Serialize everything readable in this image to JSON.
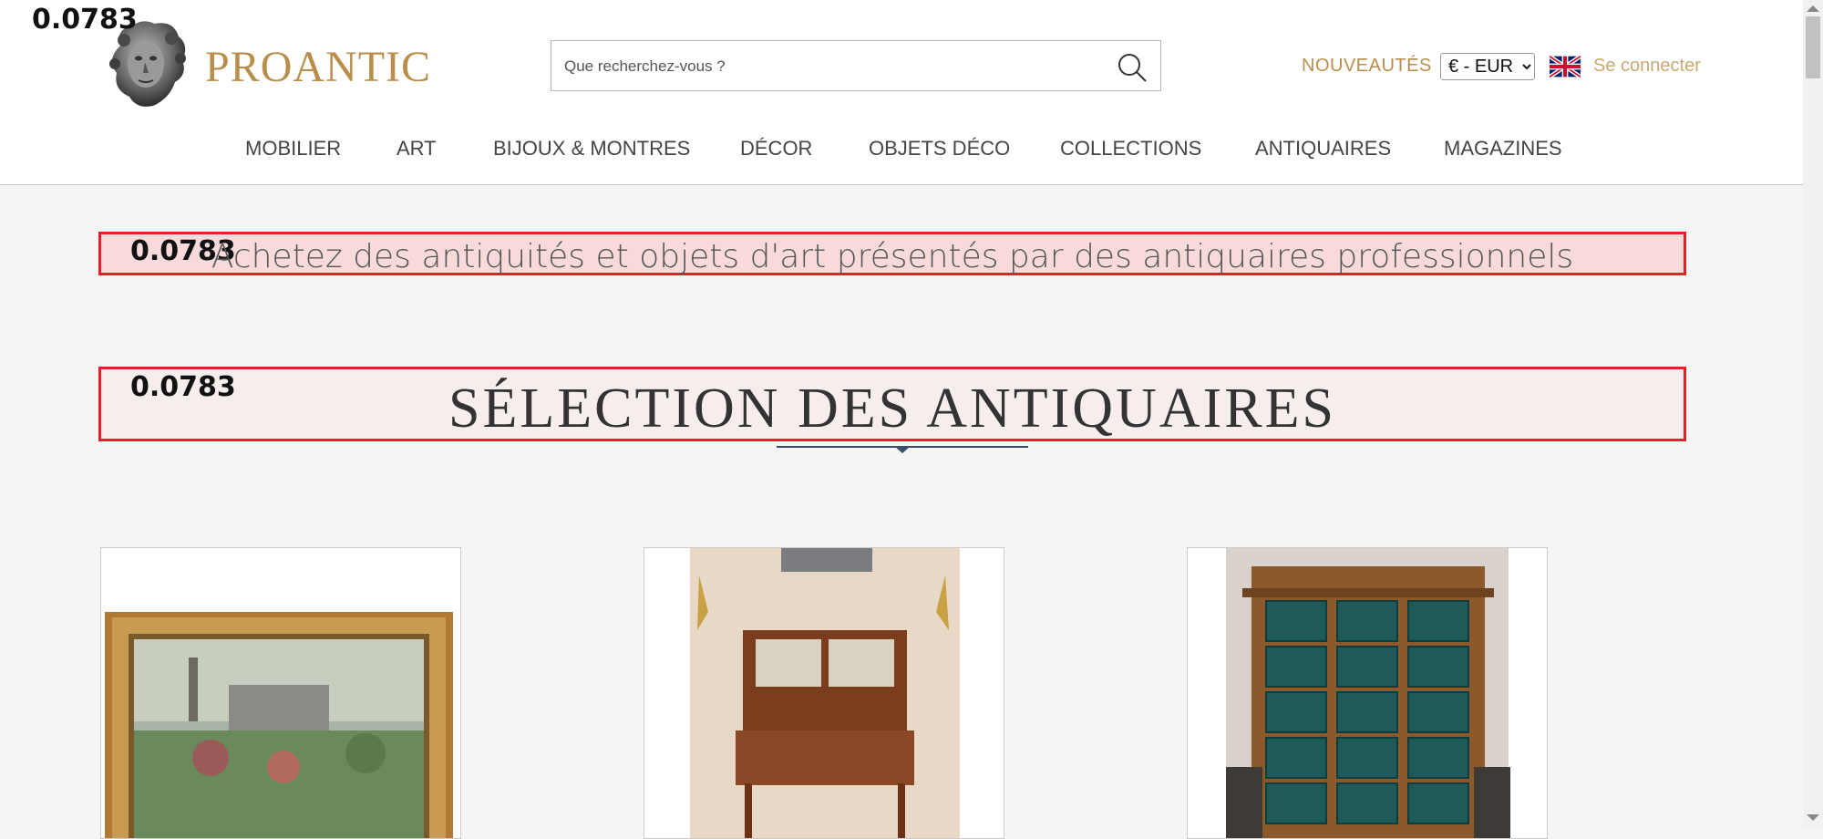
{
  "debug": {
    "score_value": "0.0783"
  },
  "brand": {
    "name": "PROANTIC",
    "color": "#b98e4b"
  },
  "search": {
    "placeholder": "Que recherchez-vous ?",
    "value": ""
  },
  "header": {
    "new_label": "NOUVEAUTÉS",
    "currency_selected": "€ - EUR",
    "currency_options": [
      "€ - EUR"
    ],
    "login_label": "Se connecter"
  },
  "nav": {
    "items": [
      {
        "label": "MOBILIER"
      },
      {
        "label": "ART"
      },
      {
        "label": "BIJOUX & MONTRES"
      },
      {
        "label": "DÉCOR"
      },
      {
        "label": "OBJETS DÉCO"
      },
      {
        "label": "COLLECTIONS"
      },
      {
        "label": "ANTIQUAIRES"
      },
      {
        "label": "MAGAZINES"
      }
    ]
  },
  "main": {
    "tagline": "Achetez des antiquités et objets d'art présentés par des antiquaires professionnels",
    "section_title": "SÉLECTION DES ANTIQUAIRES"
  },
  "icons": {
    "logo": "statue-head-icon",
    "search": "search-icon",
    "flag": "uk-flag-icon",
    "chevron": "chevron-down-icon"
  },
  "colors": {
    "highlight_border": "#e3202a",
    "highlight_fill": "#f8dada",
    "gold": "#b98e4b"
  }
}
